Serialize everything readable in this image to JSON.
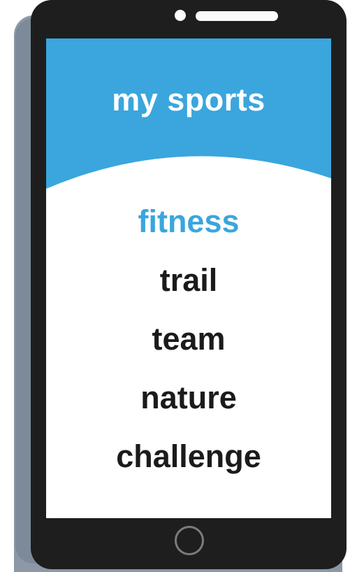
{
  "app": {
    "title": "my sports",
    "accent_color": "#3aa6dd"
  },
  "menu": {
    "items": [
      {
        "label": "fitness",
        "active": true
      },
      {
        "label": "trail",
        "active": false
      },
      {
        "label": "team",
        "active": false
      },
      {
        "label": "nature",
        "active": false
      },
      {
        "label": "challenge",
        "active": false
      }
    ]
  },
  "device": {
    "home_button_icon": "home-circle-icon",
    "camera_icon": "camera-dot-icon",
    "speaker_icon": "speaker-grille-icon"
  }
}
